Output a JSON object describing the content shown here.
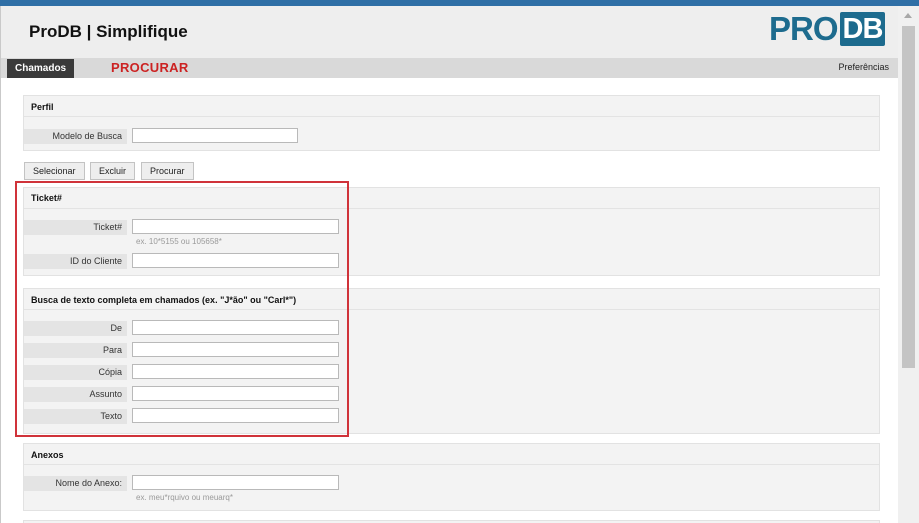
{
  "app": {
    "title": "ProDB | Simplifique",
    "logo_pro": "PRO",
    "logo_db": "DB"
  },
  "nav": {
    "tab": "Chamados",
    "annotation": "PROCURAR",
    "preferences": "Preferências"
  },
  "perfil": {
    "title": "Perfil",
    "label": "Modelo de Busca",
    "value": ""
  },
  "buttons": {
    "select": "Selecionar",
    "delete": "Excluir",
    "search": "Procurar"
  },
  "ticket": {
    "title": "Ticket#",
    "ticket_label": "Ticket#",
    "ticket_value": "",
    "ticket_hint": "ex. 10*5155 ou 105658*",
    "customer_label": "ID do Cliente",
    "customer_value": ""
  },
  "fulltext": {
    "title": "Busca de texto completa em chamados (ex. \"J*ão\" ou \"Carl*\")",
    "fields": [
      {
        "label": "De",
        "value": ""
      },
      {
        "label": "Para",
        "value": ""
      },
      {
        "label": "Cópia",
        "value": ""
      },
      {
        "label": "Assunto",
        "value": ""
      },
      {
        "label": "Texto",
        "value": ""
      }
    ]
  },
  "anexos": {
    "title": "Anexos",
    "label": "Nome do Anexo:",
    "value": "",
    "hint": "ex. meu*rquivo ou meuarq*"
  },
  "colors": {
    "accent_red": "#d0333a",
    "brand_blue": "#1d6b8e"
  }
}
